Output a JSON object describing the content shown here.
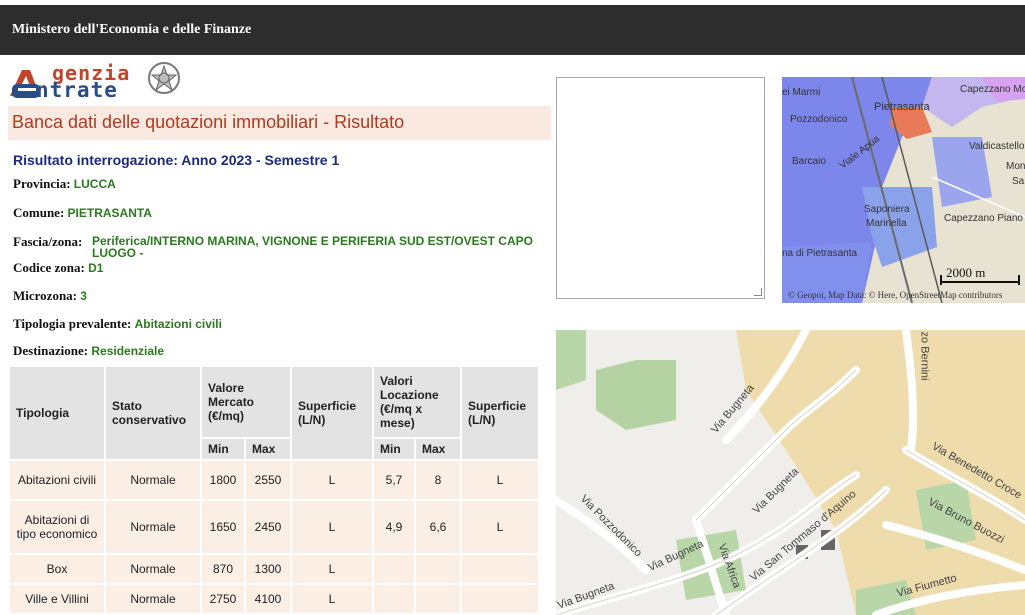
{
  "header": {
    "title": "Ministero dell'Economia e delle Finanze"
  },
  "logo": {
    "line1": "genzia",
    "line2": "ntrate"
  },
  "page_title": "Banca dati delle quotazioni immobiliari - Risultato",
  "result": {
    "heading": "Risultato interrogazione: Anno 2023 - Semestre 1",
    "provincia_label": "Provincia:",
    "provincia": "LUCCA",
    "comune_label": "Comune:",
    "comune": "PIETRASANTA",
    "fascia_label": "Fascia/zona:",
    "fascia": "Periferica/INTERNO MARINA, VIGNONE E PERIFERIA SUD EST/OVEST CAPO LUOGO -",
    "codice_label": "Codice zona:",
    "codice": "D1",
    "microzona_label": "Microzona:",
    "microzona": "3",
    "tipologia_label": "Tipologia prevalente:",
    "tipologia": "Abitazioni civili",
    "destinazione_label": "Destinazione:",
    "destinazione": "Residenziale"
  },
  "table": {
    "h_tipologia": "Tipologia",
    "h_stato": "Stato conservativo",
    "h_valore": "Valore Mercato (€/mq)",
    "h_superficie": "Superficie (L/N)",
    "h_locazione": "Valori Locazione (€/mq x mese)",
    "h_superficie2": "Superficie (L/N)",
    "h_min": "Min",
    "h_max": "Max",
    "h_min2": "Min",
    "h_max2": "Max",
    "rows": [
      {
        "tipologia": "Abitazioni civili",
        "stato": "Normale",
        "min": "1800",
        "max": "2550",
        "sup": "L",
        "lmin": "5,7",
        "lmax": "8",
        "sup2": "L"
      },
      {
        "tipologia": "Abitazioni di tipo economico",
        "stato": "Normale",
        "min": "1650",
        "max": "2450",
        "sup": "L",
        "lmin": "4,9",
        "lmax": "6,6",
        "sup2": "L"
      },
      {
        "tipologia": "Box",
        "stato": "Normale",
        "min": "870",
        "max": "1300",
        "sup": "L",
        "lmin": "",
        "lmax": "",
        "sup2": ""
      },
      {
        "tipologia": "Ville e Villini",
        "stato": "Normale",
        "min": "2750",
        "max": "4100",
        "sup": "L",
        "lmin": "",
        "lmax": "",
        "sup2": ""
      }
    ]
  },
  "small_map": {
    "labels": [
      "ei Marmi",
      "Capezzano Monte",
      "Pietrasanta",
      "Pozzodonico",
      "Valdicastello",
      "Barcaio",
      "Viale Apua",
      "Monti",
      "Sa",
      "Saponiera",
      "Marinella",
      "Capezzano Piano",
      "na di Pietrasanta"
    ],
    "scale": "2000 m",
    "attribution": "© Geopoi, Map Data: © Here, OpenStreetMap contributors"
  },
  "big_map": {
    "streets": [
      "Via Bugneta",
      "Via Bugneta",
      "Via Bugneta",
      "Via Bugneta",
      "Via Pozzodonico",
      "Via Africa",
      "Via San Tommaso d'Aquino",
      "Via Benedetto Croce",
      "Via Bruno Buozzi",
      "Via Fiumetto",
      "zo Bernini"
    ]
  }
}
